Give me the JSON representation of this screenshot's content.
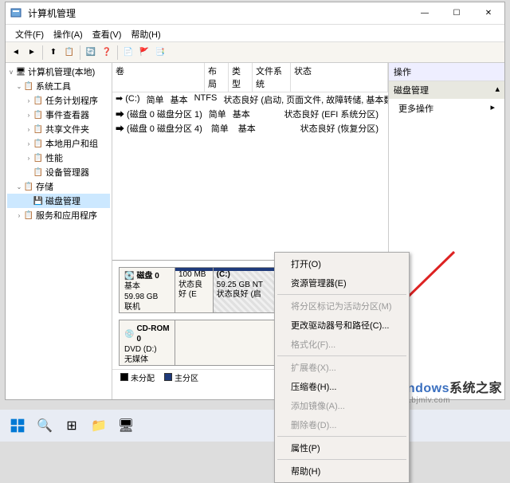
{
  "window": {
    "title": "计算机管理",
    "controls": {
      "min": "—",
      "max": "☐",
      "close": "✕"
    }
  },
  "menubar": [
    "文件(F)",
    "操作(A)",
    "查看(V)",
    "帮助(H)"
  ],
  "tree": {
    "root": "计算机管理(本地)",
    "items": [
      {
        "label": "系统工具",
        "level": 2,
        "exp": "v"
      },
      {
        "label": "任务计划程序",
        "level": 3,
        "exp": ">"
      },
      {
        "label": "事件查看器",
        "level": 3,
        "exp": ">"
      },
      {
        "label": "共享文件夹",
        "level": 3,
        "exp": ">"
      },
      {
        "label": "本地用户和组",
        "level": 3,
        "exp": ">"
      },
      {
        "label": "性能",
        "level": 3,
        "exp": ">"
      },
      {
        "label": "设备管理器",
        "level": 3,
        "exp": ""
      },
      {
        "label": "存储",
        "level": 2,
        "exp": "v"
      },
      {
        "label": "磁盘管理",
        "level": 3,
        "exp": "",
        "sel": true
      },
      {
        "label": "服务和应用程序",
        "level": 2,
        "exp": ">"
      }
    ]
  },
  "vol_headers": {
    "name": "卷",
    "layout": "布局",
    "type": "类型",
    "fs": "文件系统",
    "status": "状态"
  },
  "volumes": [
    {
      "name": "(C:)",
      "layout": "简单",
      "type": "基本",
      "fs": "NTFS",
      "status": "状态良好 (启动, 页面文件, 故障转储, 基本数据"
    },
    {
      "name": "(磁盘 0 磁盘分区 1)",
      "layout": "简单",
      "type": "基本",
      "fs": "",
      "status": "状态良好 (EFI 系统分区)"
    },
    {
      "name": "(磁盘 0 磁盘分区 4)",
      "layout": "简单",
      "type": "基本",
      "fs": "",
      "status": "状态良好 (恢复分区)"
    }
  ],
  "disks": [
    {
      "name": "磁盘 0",
      "kind": "基本",
      "size": "59.98 GB",
      "state": "联机",
      "parts": [
        {
          "label": "",
          "size": "100 MB",
          "status": "状态良好 (E",
          "flex": 1
        },
        {
          "label": "(C:)",
          "size": "59.25 GB NT",
          "status": "状态良好 (启",
          "flex": 2,
          "sel": true
        },
        {
          "label": "",
          "size": "",
          "status": "",
          "flex": 3
        }
      ]
    },
    {
      "name": "CD-ROM 0",
      "kind": "DVD (D:)",
      "size": "",
      "state": "无媒体",
      "parts": []
    }
  ],
  "legend": {
    "unalloc": "未分配",
    "primary": "主分区"
  },
  "actions": {
    "header": "操作",
    "sub": "磁盘管理",
    "more": "更多操作"
  },
  "ctxmenu": [
    {
      "t": "打开(O)"
    },
    {
      "t": "资源管理器(E)"
    },
    {
      "sep": true
    },
    {
      "t": "将分区标记为活动分区(M)",
      "d": true
    },
    {
      "t": "更改驱动器号和路径(C)..."
    },
    {
      "t": "格式化(F)...",
      "d": true
    },
    {
      "sep": true
    },
    {
      "t": "扩展卷(X)...",
      "d": true
    },
    {
      "t": "压缩卷(H)..."
    },
    {
      "t": "添加镜像(A)...",
      "d": true
    },
    {
      "t": "删除卷(D)...",
      "d": true
    },
    {
      "sep": true
    },
    {
      "t": "属性(P)"
    },
    {
      "sep": true
    },
    {
      "t": "帮助(H)"
    }
  ],
  "watermark": {
    "brand": "Windows",
    "sub": "系统之家",
    "url": "www.bjmlv.com"
  }
}
